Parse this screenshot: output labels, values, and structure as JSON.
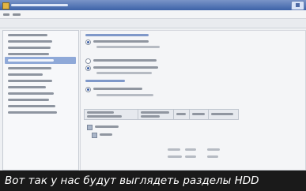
{
  "caption": {
    "text": "Вот так у нас будут выглядеть разделы HDD"
  },
  "colors": {
    "titlebar": "#3d62a8",
    "selection": "#8fa9d8",
    "caption_bg": "#1a1a1a",
    "caption_text": "#ffffff"
  },
  "icons": {
    "title": "app-icon",
    "close": "close-icon",
    "radio_selected": "radio-selected-icon",
    "radio_unselected": "radio-unselected-icon",
    "tree_node": "tree-node-icon"
  }
}
